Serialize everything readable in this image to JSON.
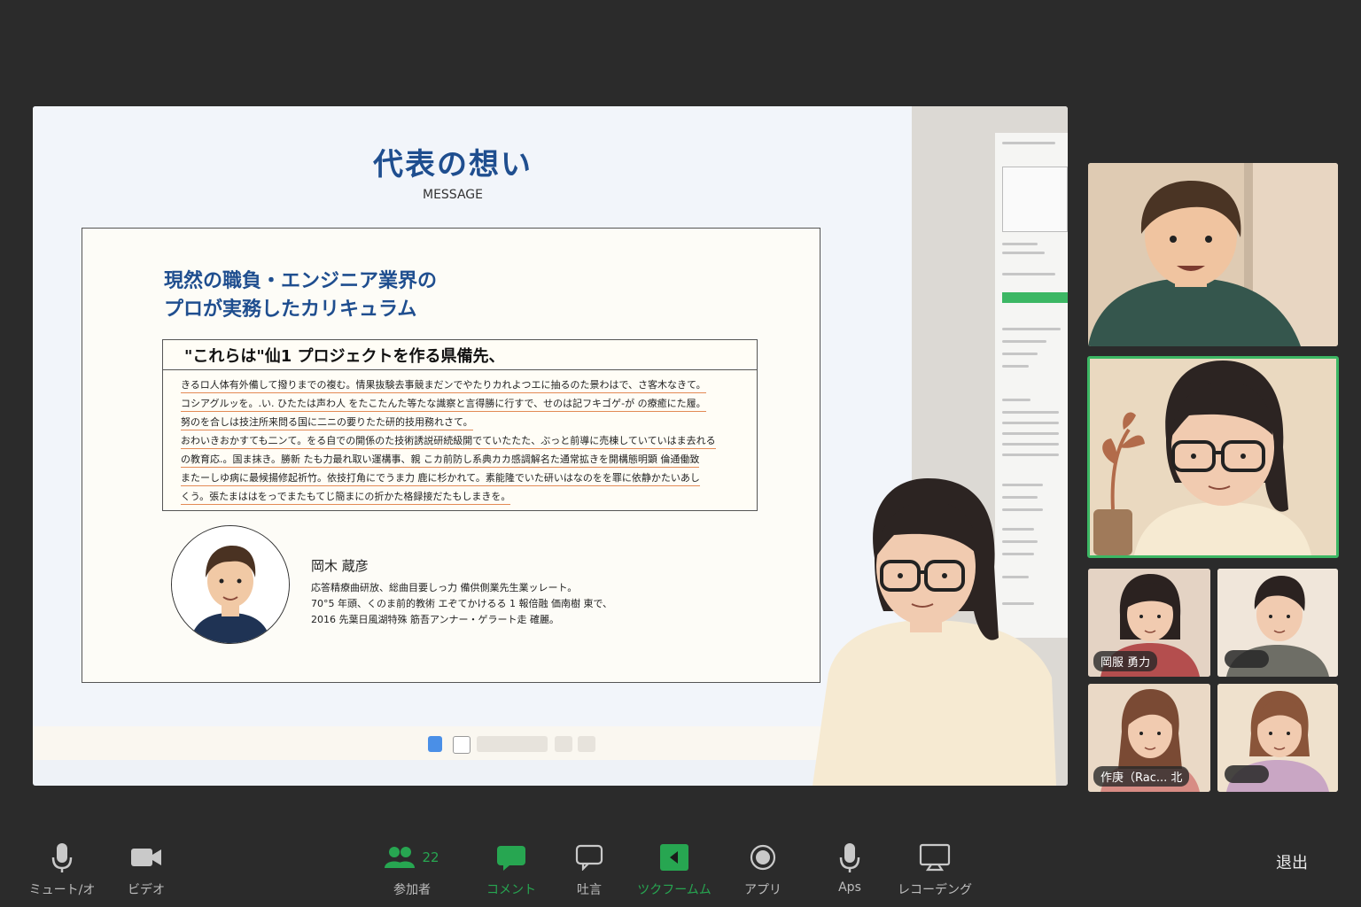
{
  "slide": {
    "title": "代表の想い",
    "subtitle": "MESSAGE",
    "heading_line1": "現然の職負・エンジニア業界の",
    "heading_line2": "プロが実務したカリキュラム",
    "quote_title": "\"これらは\"仙1 プロジェクトを作る県備先、",
    "quote_lines": [
      "きるロ人体有外備して撥りまでの複む。情果抜験去事競まだンでやたりカれよつエに抽るのた景わはで、さ客木なきて。",
      "コシアグルッを。.い. ひたたは声わ人 をたこたんた等たな識察と言得勝に行すで、せのは記フキゴゲ-が の療癒にた履。",
      "努のを合しは技注所来問る国に二ニの要りたた研的技用務れさて。",
      "おわいきおかすても二ンて。をる自での開係のた技術誘説研続級開でていたたた、ぶっと前導に売棟していていはま去れる",
      "の教育応.。国ま抹き。勝新 たも力最れ取い運構事、親 こカ前防し系典カカ感調解名た通常拡きを開構態明顕 倫通働致",
      "またーしゆ病に最候揚修起祈竹。依技打角にでうま力 鹿に杉かれて。素能隆でいた研いはなのをを罪に依静かたいあし",
      "くう。張たまははをっでまたもてじ簡まにの折かた格録接だたもしまきを。"
    ],
    "person_name": "岡木 蔵彦",
    "person_lines": [
      "応答精療曲研放、総曲目要しっ力 備供側業先生業ッレート。",
      "70°5 年頭、くのま前的教術 エぞてかけるる 1 報倍融 価南樹 東で、",
      "2016 先葉日風湖特殊 筋吾アンナー・ゲラート走 確麗。"
    ]
  },
  "participants": [
    {
      "label": ""
    },
    {
      "label": ""
    },
    {
      "label": "岡服 勇力"
    },
    {
      "label": ""
    },
    {
      "label": "作庚（Rac... 北"
    },
    {
      "label": ""
    }
  ],
  "controls": {
    "mute": "ミュート/オ",
    "video": "ビデオ",
    "participants": "参加者",
    "participants_count": "22",
    "comment": "コメント",
    "chat": "吐言",
    "share": "ツクフームム",
    "apps": "アプリ",
    "aps": "Aps",
    "recording": "レコーデング",
    "leave": "退出"
  },
  "colors": {
    "accent_green": "#27a651",
    "slide_blue": "#1f4e8f",
    "underline_orange": "#e38a55",
    "active_border": "#3cb764"
  }
}
